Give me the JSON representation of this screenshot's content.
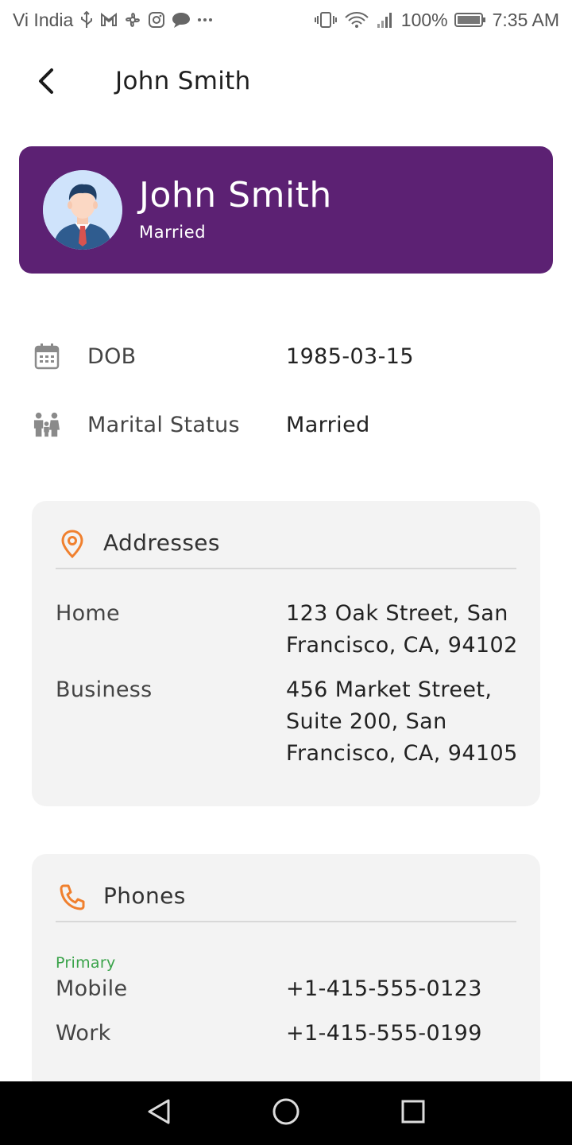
{
  "status_bar": {
    "carrier": "Vi India",
    "battery": "100%",
    "time": "7:35 AM"
  },
  "app_bar": {
    "title": "John Smith"
  },
  "profile": {
    "name": "John Smith",
    "status": "Married"
  },
  "details": {
    "dob_label": "DOB",
    "dob_value": "1985-03-15",
    "marital_label": "Marital Status",
    "marital_value": "Married"
  },
  "addresses": {
    "title": "Addresses",
    "items": [
      {
        "label": "Home",
        "value": "123 Oak Street, San Francisco, CA, 94102"
      },
      {
        "label": "Business",
        "value": "456 Market Street, Suite 200, San Francisco, CA, 94105"
      }
    ]
  },
  "phones": {
    "title": "Phones",
    "primary_tag": "Primary",
    "items": [
      {
        "label": "Mobile",
        "value": "+1-415-555-0123"
      },
      {
        "label": "Work",
        "value": "+1-415-555-0199"
      }
    ]
  },
  "colors": {
    "accent": "#5c2173",
    "icon_orange": "#f0802e",
    "primary_green": "#3aa34a"
  }
}
